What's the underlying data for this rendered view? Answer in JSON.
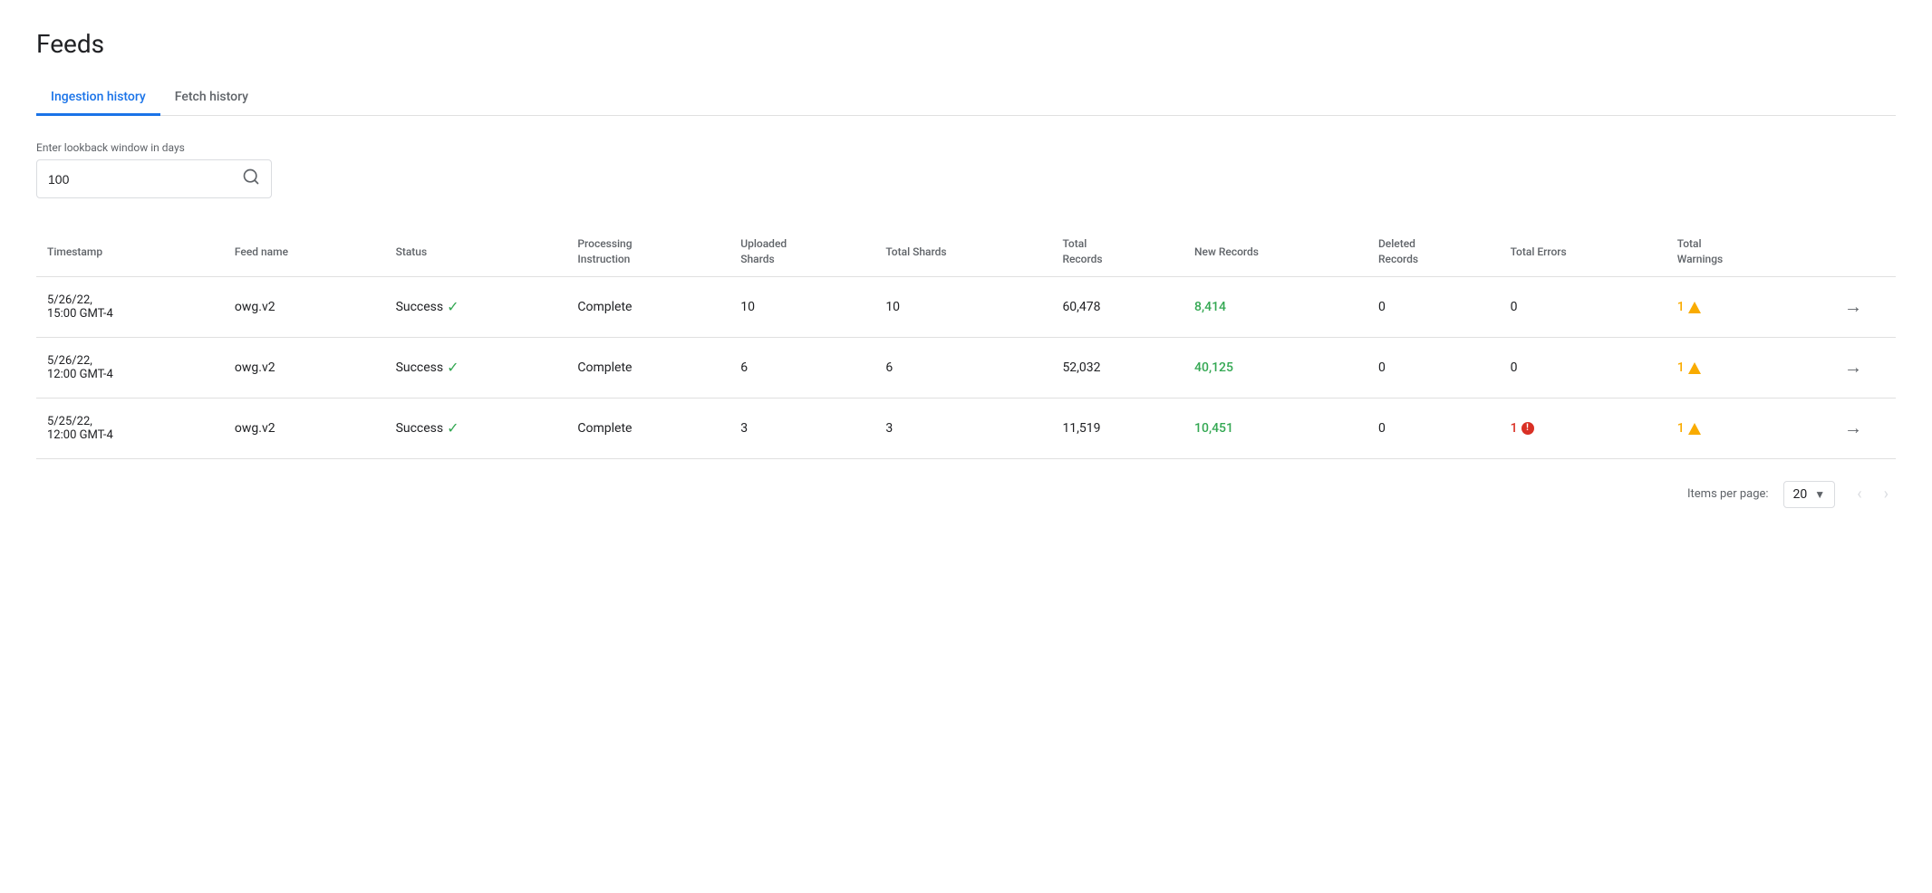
{
  "page": {
    "title": "Feeds"
  },
  "tabs": [
    {
      "id": "ingestion",
      "label": "Ingestion history",
      "active": true
    },
    {
      "id": "fetch",
      "label": "Fetch history",
      "active": false
    }
  ],
  "search": {
    "label": "Enter lookback window in days",
    "value": "100",
    "placeholder": ""
  },
  "table": {
    "columns": [
      {
        "id": "timestamp",
        "label": "Timestamp"
      },
      {
        "id": "feed_name",
        "label": "Feed name"
      },
      {
        "id": "status",
        "label": "Status"
      },
      {
        "id": "processing_instruction",
        "label": "Processing\nInstruction"
      },
      {
        "id": "uploaded_shards",
        "label": "Uploaded\nShards"
      },
      {
        "id": "total_shards",
        "label": "Total Shards"
      },
      {
        "id": "total_records",
        "label": "Total\nRecords"
      },
      {
        "id": "new_records",
        "label": "New Records"
      },
      {
        "id": "deleted_records",
        "label": "Deleted\nRecords"
      },
      {
        "id": "total_errors",
        "label": "Total Errors"
      },
      {
        "id": "total_warnings",
        "label": "Total\nWarnings"
      },
      {
        "id": "action",
        "label": ""
      }
    ],
    "rows": [
      {
        "timestamp": "5/26/22,\n15:00 GMT-4",
        "feed_name": "owg.v2",
        "status": "Success",
        "processing_instruction": "Complete",
        "uploaded_shards": "10",
        "total_shards": "10",
        "total_records": "60,478",
        "new_records": "8,414",
        "deleted_records": "0",
        "total_errors": "0",
        "total_warnings": "1",
        "warnings_icon": "warning",
        "errors_icon": ""
      },
      {
        "timestamp": "5/26/22,\n12:00 GMT-4",
        "feed_name": "owg.v2",
        "status": "Success",
        "processing_instruction": "Complete",
        "uploaded_shards": "6",
        "total_shards": "6",
        "total_records": "52,032",
        "new_records": "40,125",
        "deleted_records": "0",
        "total_errors": "0",
        "total_warnings": "1",
        "warnings_icon": "warning",
        "errors_icon": ""
      },
      {
        "timestamp": "5/25/22,\n12:00 GMT-4",
        "feed_name": "owg.v2",
        "status": "Success",
        "processing_instruction": "Complete",
        "uploaded_shards": "3",
        "total_shards": "3",
        "total_records": "11,519",
        "new_records": "10,451",
        "deleted_records": "0",
        "total_errors": "1",
        "total_warnings": "1",
        "warnings_icon": "warning",
        "errors_icon": "error"
      }
    ]
  },
  "pagination": {
    "items_per_page_label": "Items per page:",
    "items_per_page_value": "20",
    "prev_disabled": true,
    "next_disabled": true
  }
}
